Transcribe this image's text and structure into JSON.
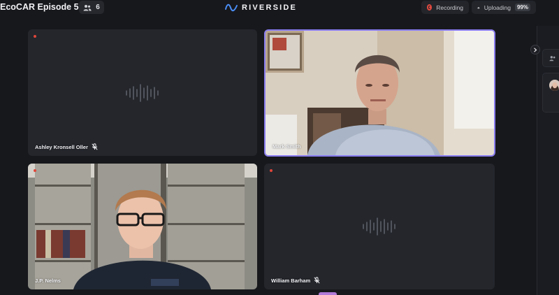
{
  "header": {
    "title": "EcoCAR Episode 5",
    "participant_count": "6",
    "brand_name": "RIVERSIDE",
    "recording_label": "Recording",
    "uploading_label": "Uploading",
    "uploading_percent": "99%",
    "upload_progress_fraction": 0.99
  },
  "tiles": [
    {
      "name": "Ashley Kronsell Oller",
      "muted": true,
      "video": false,
      "active": false
    },
    {
      "name": "Mark Smith",
      "muted": false,
      "video": true,
      "active": true
    },
    {
      "name": "J.P. Nelms",
      "muted": false,
      "video": true,
      "active": false
    },
    {
      "name": "William Barham",
      "muted": true,
      "video": false,
      "active": false
    }
  ],
  "icons": {
    "participants": "people-icon",
    "brand": "wave-logo-icon",
    "recording": "record-icon",
    "uploading": "cloud-upload-icon",
    "muted": "mic-off-icon",
    "audio": "audio-wave-icon",
    "panel": "chevron-right-icon"
  },
  "colors": {
    "background": "#17181c",
    "tile": "#24262c",
    "active_border": "#8a7df0",
    "recording_red": "#e34a3f",
    "brand_blue": "#4a8df5"
  }
}
